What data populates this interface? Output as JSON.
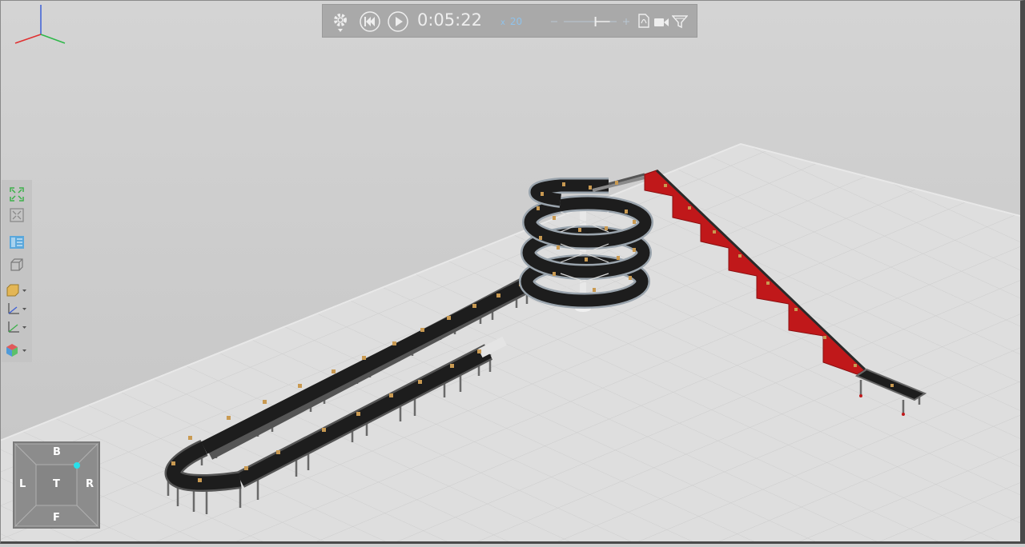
{
  "toolbar": {
    "time": "0:05:22",
    "speed_multiplier_symbol": "x",
    "speed_value": "20",
    "settings_icon": "gear-icon",
    "reset_icon": "skip-to-start-icon",
    "play_icon": "play-icon",
    "pdf_icon": "pdf-icon",
    "record_icon": "video-camera-icon",
    "filter_icon": "filter-icon",
    "speed_slider_level": 0.6
  },
  "left_panel": {
    "items": [
      "fit-all-icon",
      "fit-selection-icon",
      "layout-icon",
      "box-view-icon",
      "object-dropdown-icon",
      "axes-dropdown-icon",
      "ruler-dropdown-icon",
      "cube-dropdown-icon"
    ]
  },
  "nav_cube": {
    "top": "B",
    "left": "L",
    "center": "T",
    "right": "R",
    "bottom": "F"
  },
  "colors": {
    "background": "#cfcfcf",
    "floor": "#dedede",
    "conveyor": "#222222",
    "stair_red": "#c0181a",
    "box": "#c99a52",
    "accent": "#8fc2ea"
  }
}
